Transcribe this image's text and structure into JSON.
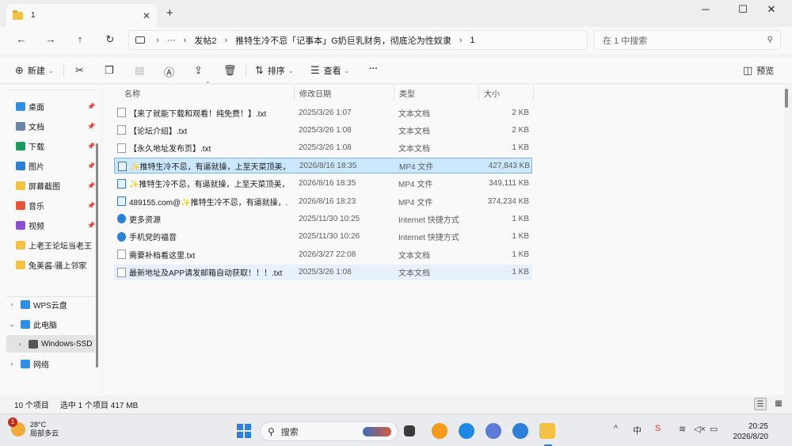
{
  "tab": {
    "title": "1",
    "close": "✕",
    "new_tab": "+"
  },
  "window_controls": {
    "minimize": "─",
    "maximize": "☐",
    "close": "✕"
  },
  "nav": {
    "back": "←",
    "forward": "→",
    "up": "↑",
    "refresh": "↻"
  },
  "address": {
    "sep1": "›",
    "more": "···",
    "segments": [
      "发帖2",
      "推特生冷不忌「记事本」G奶巨乳财务，彻底沦为性奴隶",
      "1"
    ],
    "sep": "›"
  },
  "search": {
    "placeholder": "在 1 中搜索"
  },
  "toolbar": {
    "new_label": "新建",
    "sort_label": "排序",
    "view_label": "查看",
    "more_label": "···",
    "preview_label": "预览"
  },
  "sidebar": {
    "pinned": [
      {
        "label": "桌面",
        "icon": "desktop-icon",
        "color": "#2f8ee6"
      },
      {
        "label": "文档",
        "icon": "document-icon",
        "color": "#6a86a8"
      },
      {
        "label": "下载",
        "icon": "download-icon",
        "color": "#1a9c5b"
      },
      {
        "label": "图片",
        "icon": "pictures-icon",
        "color": "#2a7fd4"
      },
      {
        "label": "屏幕截图",
        "icon": "folder-icon",
        "color": "#f4c243"
      },
      {
        "label": "音乐",
        "icon": "music-icon",
        "color": "#e8553a"
      },
      {
        "label": "视频",
        "icon": "video-icon",
        "color": "#8b4fd6"
      },
      {
        "label": "上老王论坛当老王",
        "icon": "folder-icon",
        "color": "#f4c243"
      },
      {
        "label": "兔美酱-骚上邻家",
        "icon": "folder-icon",
        "color": "#f4c243"
      }
    ],
    "tree": [
      {
        "label": "WPS云盘",
        "icon": "cloud-icon",
        "color": "#2f8ee6",
        "chev": "›"
      },
      {
        "label": "此电脑",
        "icon": "computer-icon",
        "color": "#2f8ee6",
        "chev": "⌄"
      },
      {
        "label": "Windows-SSD",
        "icon": "drive-icon",
        "color": "#555555",
        "chev": "›"
      },
      {
        "label": "网络",
        "icon": "network-icon",
        "color": "#2f8ee6",
        "chev": "›"
      }
    ]
  },
  "columns": {
    "name": "名称",
    "modified": "修改日期",
    "type": "类型",
    "size": "大小"
  },
  "files": [
    {
      "name": "【来了就能下载和观看！纯免费！】.txt",
      "modified": "2025/3/26 1:07",
      "type": "文本文档",
      "size": "2 KB",
      "icon": "text-file-icon"
    },
    {
      "name": "【论坛介绍】.txt",
      "modified": "2025/3/26 1:08",
      "type": "文本文档",
      "size": "2 KB",
      "icon": "text-file-icon"
    },
    {
      "name": "【永久地址发布页】.txt",
      "modified": "2025/3/26 1:08",
      "type": "文本文档",
      "size": "1 KB",
      "icon": "text-file-icon"
    },
    {
      "name": "✨推特生冷不忌，有逼就操，上至天菜顶美，...",
      "modified": "2026/8/16 18:35",
      "type": "MP4 文件",
      "size": "427,843 KB",
      "icon": "video-file-icon"
    },
    {
      "name": "✨推特生冷不忌，有逼就操，上至天菜顶美，...",
      "modified": "2026/8/16 18:35",
      "type": "MP4 文件",
      "size": "349,111 KB",
      "icon": "video-file-icon"
    },
    {
      "name": "489155.com@✨推特生冷不忌，有逼就操，...",
      "modified": "2026/8/16 18:23",
      "type": "MP4 文件",
      "size": "374,234 KB",
      "icon": "video-file-icon"
    },
    {
      "name": "更多资源",
      "modified": "2025/11/30 10:25",
      "type": "Internet 快捷方式",
      "size": "1 KB",
      "icon": "internet-shortcut-icon"
    },
    {
      "name": "手机党的福音",
      "modified": "2025/11/30 10:26",
      "type": "Internet 快捷方式",
      "size": "1 KB",
      "icon": "internet-shortcut-icon"
    },
    {
      "name": "需要补档看这里.txt",
      "modified": "2026/3/27 22:08",
      "type": "文本文档",
      "size": "1 KB",
      "icon": "text-file-icon"
    },
    {
      "name": "最新地址及APP请发邮箱自动获取！！！.txt",
      "modified": "2025/3/26 1:08",
      "type": "文本文档",
      "size": "1 KB",
      "icon": "text-file-icon"
    }
  ],
  "status": {
    "count": "10 个项目",
    "selected": "选中 1 个项目  417 MB"
  },
  "taskbar": {
    "weather_temp": "28°C",
    "weather_desc": "局部多云",
    "weather_badge": "1",
    "search_label": "搜索",
    "tray_ime": "中",
    "tray_chevron": "^",
    "time": "20:25",
    "date": "2026/8/20"
  },
  "colors": {
    "selection_bg": "#cce8ff",
    "selection_border": "#7fb4e6",
    "folder": "#f4c243"
  }
}
